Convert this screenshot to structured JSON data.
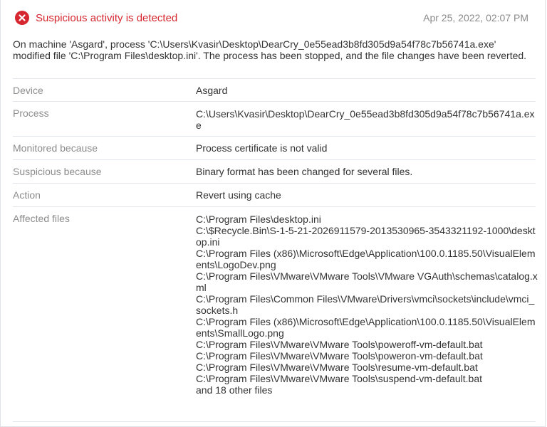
{
  "alert": {
    "title": "Suspicious activity is detected",
    "timestamp": "Apr 25, 2022, 02:07 PM",
    "icon": "error-x-icon",
    "accent_color": "#d6262f",
    "description": "On machine 'Asgard', process 'C:\\Users\\Kvasir\\Desktop\\DearCry_0e55ead3b8fd305d9a54f78c7b56741a.exe' modified file 'C:\\Program Files\\desktop.ini'. The process has been stopped, and the file changes have been reverted."
  },
  "details": {
    "device": {
      "label": "Device",
      "value": "Asgard"
    },
    "process": {
      "label": "Process",
      "value": "C:\\Users\\Kvasir\\Desktop\\DearCry_0e55ead3b8fd305d9a54f78c7b56741a.exe"
    },
    "monitored": {
      "label": "Monitored because",
      "value": "Process certificate is not valid"
    },
    "suspicious": {
      "label": "Suspicious because",
      "value": "Binary format has been changed for several files."
    },
    "action": {
      "label": "Action",
      "value": "Revert using cache"
    },
    "affected": {
      "label": "Affected files",
      "files": [
        "C:\\Program Files\\desktop.ini",
        "C:\\$Recycle.Bin\\S-1-5-21-2026911579-2013530965-3543321192-1000\\desktop.ini",
        "C:\\Program Files (x86)\\Microsoft\\Edge\\Application\\100.0.1185.50\\VisualElements\\LogoDev.png",
        "C:\\Program Files\\VMware\\VMware Tools\\VMware VGAuth\\schemas\\catalog.xml",
        "C:\\Program Files\\Common Files\\VMware\\Drivers\\vmci\\sockets\\include\\vmci_sockets.h",
        "C:\\Program Files (x86)\\Microsoft\\Edge\\Application\\100.0.1185.50\\VisualElements\\SmallLogo.png",
        "C:\\Program Files\\VMware\\VMware Tools\\poweroff-vm-default.bat",
        "C:\\Program Files\\VMware\\VMware Tools\\poweron-vm-default.bat",
        "C:\\Program Files\\VMware\\VMware Tools\\resume-vm-default.bat",
        "C:\\Program Files\\VMware\\VMware Tools\\suspend-vm-default.bat"
      ],
      "more": "and 18 other files"
    }
  }
}
